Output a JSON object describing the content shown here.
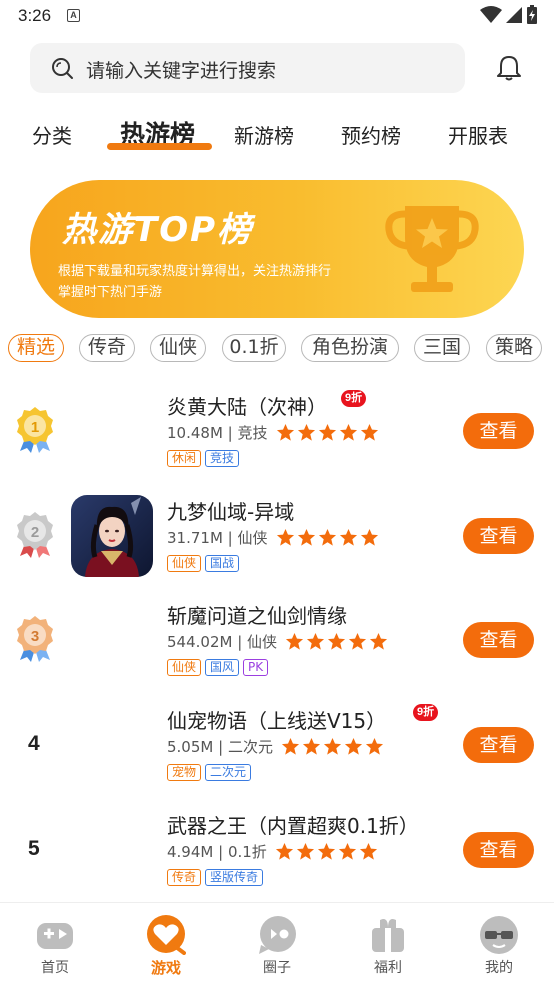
{
  "status_bar": {
    "time": "3:26",
    "notif_letter": "A"
  },
  "search": {
    "placeholder": "请输入关键字进行搜索",
    "icon": "search-icon"
  },
  "header": {
    "bell_icon": "bell-icon"
  },
  "tabs": [
    {
      "label": "分类",
      "active": false
    },
    {
      "label": "热游榜",
      "active": true
    },
    {
      "label": "新游榜",
      "active": false
    },
    {
      "label": "预约榜",
      "active": false
    },
    {
      "label": "开服表",
      "active": false
    }
  ],
  "banner": {
    "title": "热游TOP榜",
    "subtitle": "根据下载量和玩家热度计算得出，关注热游排行掌握时下热门手游",
    "icon": "trophy-icon"
  },
  "chips": [
    {
      "label": "精选",
      "active": true
    },
    {
      "label": "传奇",
      "active": false
    },
    {
      "label": "仙侠",
      "active": false
    },
    {
      "label": "0.1折",
      "active": false
    },
    {
      "label": "角色扮演",
      "active": false
    },
    {
      "label": "三国",
      "active": false
    },
    {
      "label": "策略",
      "active": false
    }
  ],
  "games": [
    {
      "rank": "1",
      "name": "炎黄大陆（次神）",
      "discount": "9折",
      "size": "10.48M",
      "category": "竞技",
      "rating_stars": 5,
      "tags": [
        {
          "label": "休闲",
          "color": "orange"
        },
        {
          "label": "竞技",
          "color": "blue"
        }
      ],
      "button": "查看",
      "has_icon": false
    },
    {
      "rank": "2",
      "name": "九梦仙域-异域",
      "discount": "",
      "size": "31.71M",
      "category": "仙侠",
      "rating_stars": 5,
      "tags": [
        {
          "label": "仙侠",
          "color": "orange"
        },
        {
          "label": "国战",
          "color": "blue"
        }
      ],
      "button": "查看",
      "has_icon": true
    },
    {
      "rank": "3",
      "name": "斩魔问道之仙剑情缘",
      "discount": "",
      "size": "544.02M",
      "category": "仙侠",
      "rating_stars": 5,
      "tags": [
        {
          "label": "仙侠",
          "color": "orange"
        },
        {
          "label": "国风",
          "color": "blue"
        },
        {
          "label": "PK",
          "color": "purple"
        }
      ],
      "button": "查看",
      "has_icon": false
    },
    {
      "rank": "4",
      "name": "仙宠物语（上线送V15）",
      "discount": "9折",
      "size": "5.05M",
      "category": "二次元",
      "rating_stars": 5,
      "tags": [
        {
          "label": "宠物",
          "color": "orange"
        },
        {
          "label": "二次元",
          "color": "blue"
        }
      ],
      "button": "查看",
      "has_icon": false
    },
    {
      "rank": "5",
      "name": "武器之王（内置超爽0.1折）",
      "discount": "",
      "size": "4.94M",
      "category": "0.1折",
      "rating_stars": 5,
      "tags": [
        {
          "label": "传奇",
          "color": "orange"
        },
        {
          "label": "竖版传奇",
          "color": "blue"
        }
      ],
      "button": "查看",
      "has_icon": false
    }
  ],
  "bottom_nav": [
    {
      "label": "首页",
      "icon": "gamepad-icon",
      "active": false
    },
    {
      "label": "游戏",
      "icon": "game-heart-icon",
      "active": true
    },
    {
      "label": "圈子",
      "icon": "chat-bubble-icon",
      "active": false
    },
    {
      "label": "福利",
      "icon": "gift-icon",
      "active": false
    },
    {
      "label": "我的",
      "icon": "profile-icon",
      "active": false
    }
  ],
  "colors": {
    "accent": "#f07a10",
    "button": "#f36c0c",
    "discount": "#e8141e",
    "star": "#f36c0c",
    "tag_blue": "#3a7be0",
    "tag_purple": "#9b3fe0"
  }
}
